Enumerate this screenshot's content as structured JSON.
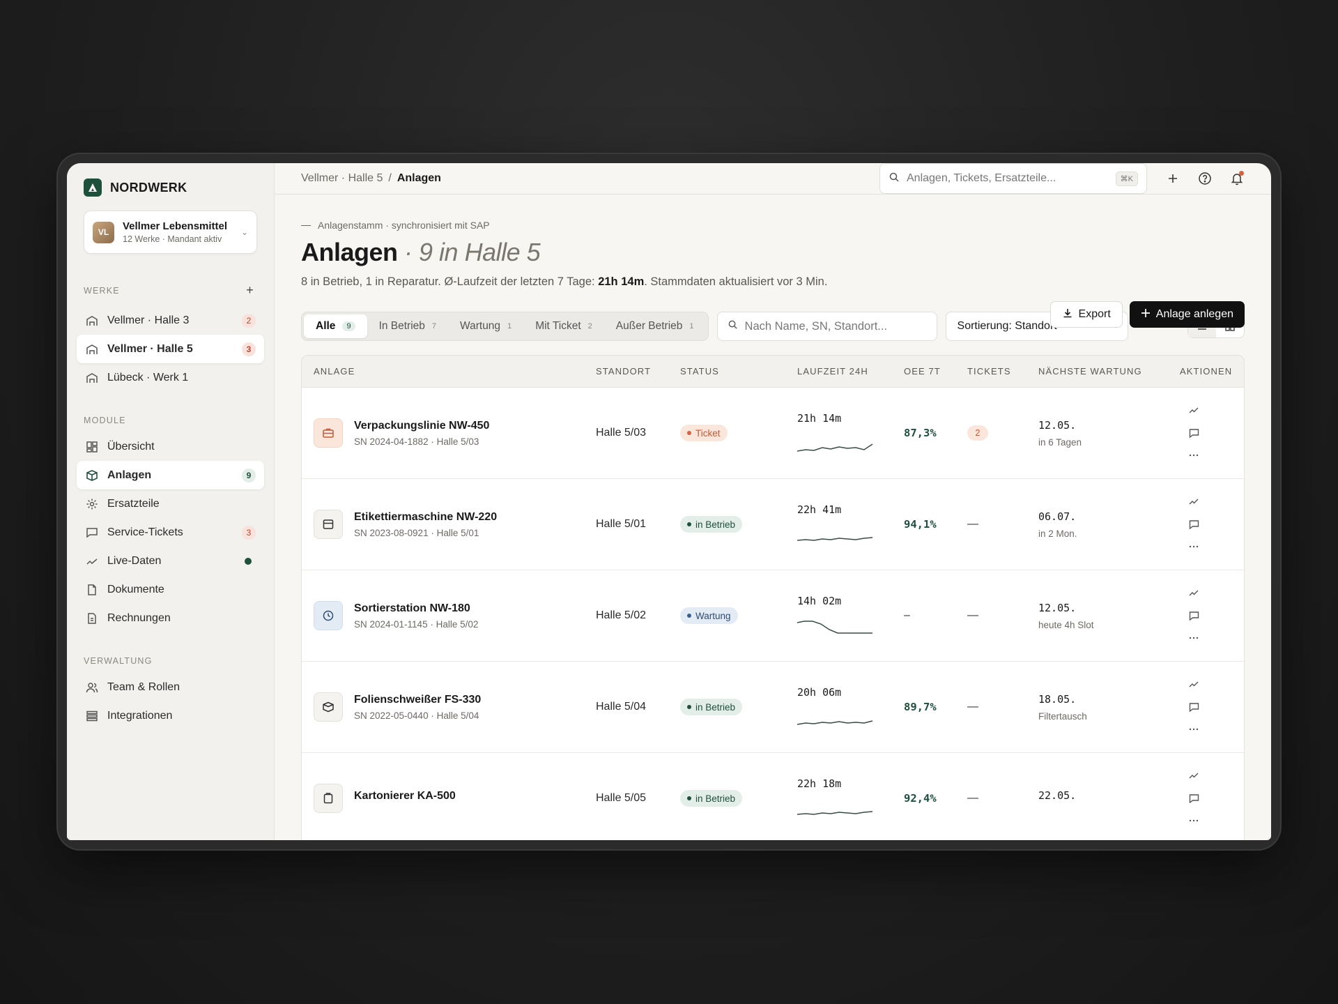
{
  "brand": {
    "name": "NORDWERK"
  },
  "tenant": {
    "initials": "VL",
    "name": "Vellmer Lebensmittel",
    "sub": "12 Werke · Mandant aktiv"
  },
  "sidebar": {
    "werke_title": "WERKE",
    "werke": [
      {
        "label": "Vellmer · Halle 3",
        "badge": "2",
        "active": false
      },
      {
        "label": "Vellmer · Halle 5",
        "badge": "3",
        "active": true
      },
      {
        "label": "Lübeck · Werk 1",
        "badge": "",
        "active": false
      }
    ],
    "module_title": "MODULE",
    "module": [
      {
        "label": "Übersicht",
        "icon": "grid-icon"
      },
      {
        "label": "Anlagen",
        "icon": "box-icon",
        "badge": "9"
      },
      {
        "label": "Ersatzteile",
        "icon": "gear-icon"
      },
      {
        "label": "Service-Tickets",
        "icon": "chat-icon",
        "badge": "3"
      },
      {
        "label": "Live-Daten",
        "icon": "trend-icon"
      },
      {
        "label": "Dokumente",
        "icon": "doc-icon"
      },
      {
        "label": "Rechnungen",
        "icon": "invoice-icon"
      }
    ],
    "verwaltung_title": "VERWALTUNG",
    "verwaltung": [
      {
        "label": "Team & Rollen",
        "icon": "users-icon"
      },
      {
        "label": "Integrationen",
        "icon": "stack-icon"
      }
    ]
  },
  "topbar": {
    "crumb_parent": "Vellmer · Halle 5",
    "crumb_sep": "/",
    "crumb_current": "Anlagen",
    "search_placeholder": "Anlagen, Tickets, Ersatzteile...",
    "shortcut": "⌘K"
  },
  "header": {
    "eyebrow": "Anlagenstamm · synchronisiert mit SAP",
    "title": "Anlagen",
    "title_sub": "· 9 in Halle 5",
    "desc_pre": "8 in Betrieb, 1 in Reparatur. Ø-Laufzeit der letzten 7 Tage: ",
    "desc_bold": "21h 14m",
    "desc_post": ". Stammdaten aktualisiert vor 3 Min.",
    "export_label": "Export",
    "create_label": "Anlage anlegen"
  },
  "filters": {
    "tabs": [
      {
        "label": "Alle",
        "count": "9"
      },
      {
        "label": "In Betrieb",
        "count": "7"
      },
      {
        "label": "Wartung",
        "count": "1"
      },
      {
        "label": "Mit Ticket",
        "count": "2"
      },
      {
        "label": "Außer Betrieb",
        "count": "1"
      }
    ],
    "search_placeholder": "Nach Name, SN, Standort...",
    "sort_label": "Sortierung: Standort"
  },
  "table": {
    "headers": {
      "anlage": "ANLAGE",
      "standort": "STANDORT",
      "status": "STATUS",
      "laufzeit": "LAUFZEIT 24H",
      "oee": "OEE 7T",
      "tickets": "TICKETS",
      "wartung": "NÄCHSTE WARTUNG",
      "aktionen": "AKTIONEN"
    },
    "rows": [
      {
        "name": "Verpackungslinie NW-450",
        "sn": "SN 2024-04-1882 · Halle 5/03",
        "standort": "Halle 5/03",
        "status": "Ticket",
        "status_kind": "ticket",
        "laufzeit": "21h 14m",
        "oee": "87,3%",
        "tickets": "2",
        "wartung_date": "12.05.",
        "wartung_sub": "in 6 Tagen",
        "icon": "briefcase-icon"
      },
      {
        "name": "Etikettiermaschine NW-220",
        "sn": "SN 2023-08-0921 · Halle 5/01",
        "standort": "Halle 5/01",
        "status": "in Betrieb",
        "status_kind": "ok",
        "laufzeit": "22h 41m",
        "oee": "94,1%",
        "tickets": "—",
        "wartung_date": "06.07.",
        "wartung_sub": "in 2 Mon.",
        "icon": "panel-icon"
      },
      {
        "name": "Sortierstation NW-180",
        "sn": "SN 2024-01-1145 · Halle 5/02",
        "standort": "Halle 5/02",
        "status": "Wartung",
        "status_kind": "wartung",
        "laufzeit": "14h 02m",
        "oee": "–",
        "tickets": "—",
        "wartung_date": "12.05.",
        "wartung_sub": "heute 4h Slot",
        "icon": "clock-icon"
      },
      {
        "name": "Folienschweißer FS-330",
        "sn": "SN 2022-05-0440 · Halle 5/04",
        "standort": "Halle 5/04",
        "status": "in Betrieb",
        "status_kind": "ok",
        "laufzeit": "20h 06m",
        "oee": "89,7%",
        "tickets": "—",
        "wartung_date": "18.05.",
        "wartung_sub": "Filtertausch",
        "icon": "package-icon"
      },
      {
        "name": "Kartonierer KA-500",
        "sn": "",
        "standort": "Halle 5/05",
        "status": "in Betrieb",
        "status_kind": "ok",
        "laufzeit": "22h 18m",
        "oee": "92,4%",
        "tickets": "—",
        "wartung_date": "22.05.",
        "wartung_sub": "",
        "icon": "clipboard-icon"
      }
    ]
  },
  "colors": {
    "brand": "#1f4f3d",
    "ticket": "#d5643f",
    "wartung": "#3b5f8c"
  }
}
